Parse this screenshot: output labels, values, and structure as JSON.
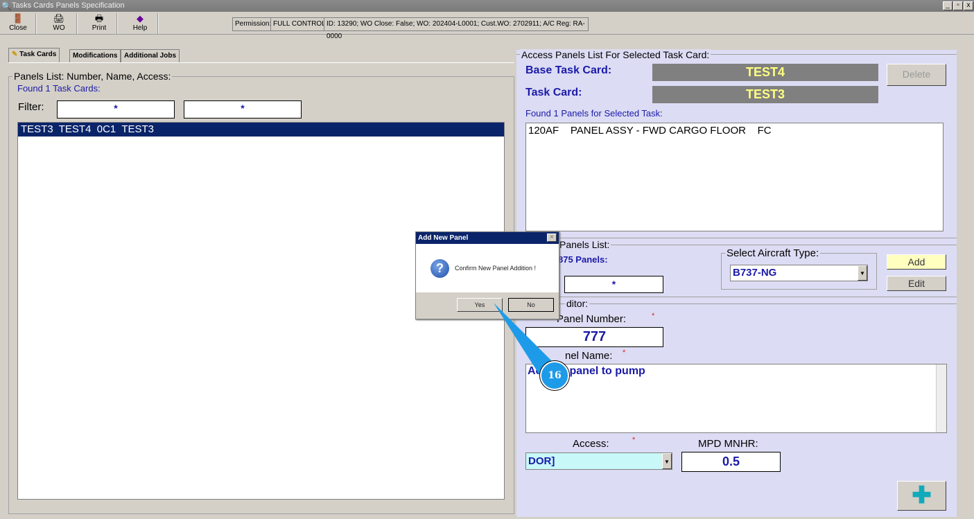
{
  "window": {
    "title": "Tasks Cards Panels Specification",
    "controls": [
      "_",
      "▫",
      "x"
    ]
  },
  "toolbar": {
    "close": "Close",
    "wo": "WO",
    "print": "Print",
    "help": "Help",
    "permission_label": "Permission:",
    "permission_value": "FULL CONTROL",
    "info": "ID: 13290; WO Close: False; WO: 202404-L0001; Cust.WO: 2702911; A/C Reg: RA-0000"
  },
  "tabs": [
    "Task Cards",
    "Modifications",
    "Additional Jobs"
  ],
  "left": {
    "group_title": "Panels List: Number, Name, Access:",
    "found": "Found 1 Task Cards:",
    "filter_label": "Filter:",
    "filter1": "*",
    "filter2": "*",
    "rows": [
      "TEST3  TEST4  0C1  TEST3"
    ]
  },
  "right": {
    "group_title": "Access Panels List For Selected Task Card:",
    "base_label": "Base Task Card:",
    "base_value": "TEST4",
    "task_label": "Task Card:",
    "task_value": "TEST3",
    "delete": "Delete",
    "found_panels": "Found 1 Panels for Selected Task:",
    "panel_rows": [
      "120AF    PANEL ASSY - FWD CARGO FLOOR    FC"
    ],
    "panels_list_title": "Panels List:",
    "found_all": "875 Panels:",
    "filter": "*",
    "aircraft_label": "Select Aircraft Type:",
    "aircraft_value": "B737-NG",
    "add": "Add",
    "edit": "Edit",
    "editor_title": "ditor:",
    "panel_number_label": "Panel Number:",
    "panel_number": "777",
    "panel_name_label": "nel Name:",
    "panel_name": "Access panel to pump",
    "access_label": "Access:",
    "access_value": "DOR]",
    "mpd_label": "MPD MNHR:",
    "mpd_value": "0.5",
    "required": "*"
  },
  "dialog": {
    "title": "Add New Panel",
    "message": "Confirm New Panel Addition !",
    "yes": "Yes",
    "no": "No"
  },
  "annotation": {
    "step": "16",
    "color": "#1e9be8"
  }
}
